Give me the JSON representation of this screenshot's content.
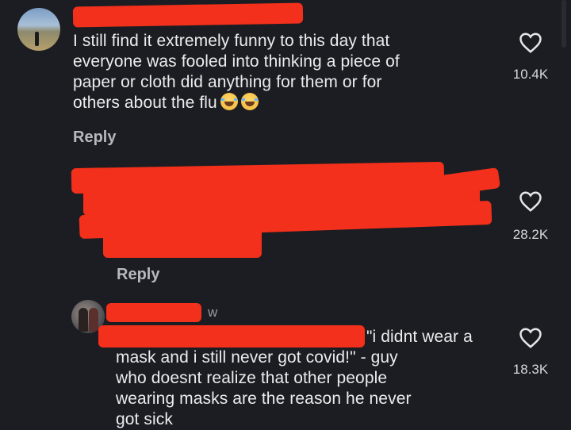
{
  "comments": [
    {
      "lines": [
        "I still find it extremely funny to this day that",
        "everyone was fooled into thinking a piece of",
        "paper or cloth did anything for them or for",
        "others about the flu"
      ],
      "emoji": [
        "laughing-tears-emoji",
        "laughing-tears-emoji"
      ],
      "reply_label": "Reply",
      "like_count": "10.4K"
    },
    {
      "reply_label": "Reply",
      "like_count": "28.2K"
    },
    {
      "timestamp_fragment": "w",
      "lines": [
        "\"i didnt wear a",
        "mask and i still never got covid!\" - guy",
        "who doesnt realize that other people",
        "wearing masks are the reason he never",
        "got sick"
      ],
      "like_count": "18.3K"
    }
  ],
  "icons": {
    "like": "heart-outline-icon"
  },
  "colors": {
    "background": "#1c1d22",
    "redaction": "#f2301b",
    "text": "#ececee"
  }
}
